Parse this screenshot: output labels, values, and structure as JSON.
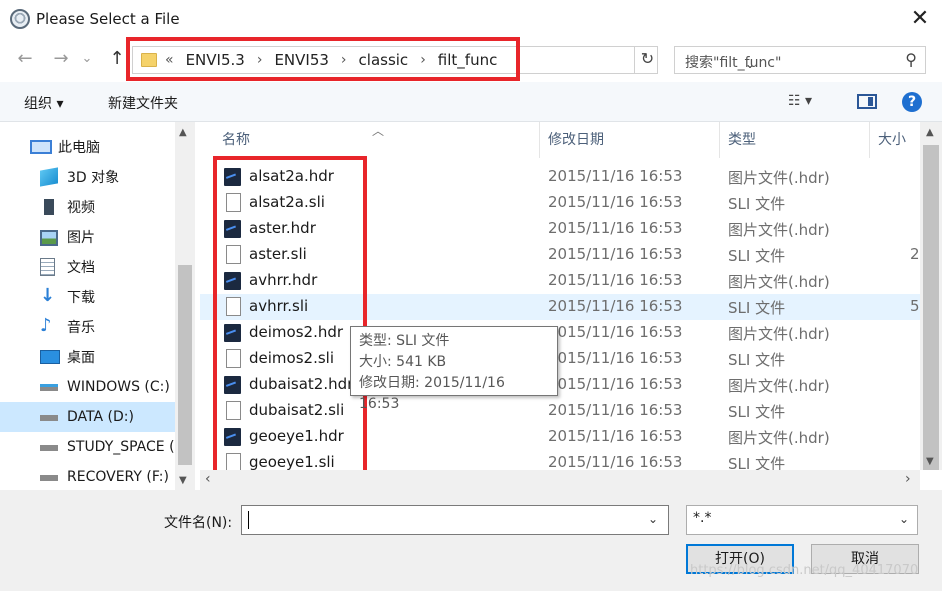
{
  "window": {
    "title": "Please Select a File",
    "close_glyph": "✕"
  },
  "nav": {
    "back_glyph": "←",
    "forward_glyph": "→",
    "dropdown_glyph": "⌄",
    "up_glyph": "↑",
    "crumb_prefix": "«",
    "breadcrumbs": [
      "ENVI5.3",
      "ENVI53",
      "classic",
      "filt_func"
    ],
    "crumb_sep": "›",
    "refresh_glyph": "↻",
    "search_placeholder": "搜索\"filt_func\"",
    "search_glyph": "⚲"
  },
  "toolbar": {
    "organize": "组织 ▾",
    "new_folder": "新建文件夹",
    "view_glyph": "☷ ▾",
    "help_glyph": "?"
  },
  "sidebar": {
    "items": [
      {
        "label": "此电脑",
        "icon": "computer-icon"
      },
      {
        "label": "3D 对象",
        "icon": "3d-objects-icon"
      },
      {
        "label": "视频",
        "icon": "video-icon"
      },
      {
        "label": "图片",
        "icon": "pictures-icon"
      },
      {
        "label": "文档",
        "icon": "documents-icon"
      },
      {
        "label": "下载",
        "icon": "downloads-icon"
      },
      {
        "label": "音乐",
        "icon": "music-icon"
      },
      {
        "label": "桌面",
        "icon": "desktop-icon"
      },
      {
        "label": "WINDOWS (C:)",
        "icon": "drive-icon"
      },
      {
        "label": "DATA (D:)",
        "icon": "drive-icon",
        "selected": true
      },
      {
        "label": "STUDY_SPACE (",
        "icon": "drive-icon"
      },
      {
        "label": "RECOVERY (F:)",
        "icon": "drive-icon"
      }
    ]
  },
  "columns": {
    "name": "名称",
    "modified": "修改日期",
    "type": "类型",
    "size": "大小"
  },
  "files": [
    {
      "name": "alsat2a.hdr",
      "date": "2015/11/16 16:53",
      "type": "图片文件(.hdr)",
      "size": "",
      "kind": "hdr"
    },
    {
      "name": "alsat2a.sli",
      "date": "2015/11/16 16:53",
      "type": "SLI 文件",
      "size": "",
      "kind": "sli"
    },
    {
      "name": "aster.hdr",
      "date": "2015/11/16 16:53",
      "type": "图片文件(.hdr)",
      "size": "",
      "kind": "hdr"
    },
    {
      "name": "aster.sli",
      "date": "2015/11/16 16:53",
      "type": "SLI 文件",
      "size": "2",
      "kind": "sli"
    },
    {
      "name": "avhrr.hdr",
      "date": "2015/11/16 16:53",
      "type": "图片文件(.hdr)",
      "size": "",
      "kind": "hdr"
    },
    {
      "name": "avhrr.sli",
      "date": "2015/11/16 16:53",
      "type": "SLI 文件",
      "size": "5",
      "kind": "sli",
      "hover": true
    },
    {
      "name": "deimos2.hdr",
      "date": "2015/11/16 16:53",
      "type": "图片文件(.hdr)",
      "size": "",
      "kind": "hdr"
    },
    {
      "name": "deimos2.sli",
      "date": "2015/11/16 16:53",
      "type": "SLI 文件",
      "size": "",
      "kind": "sli"
    },
    {
      "name": "dubaisat2.hdr",
      "date": "2015/11/16 16:53",
      "type": "图片文件(.hdr)",
      "size": "",
      "kind": "hdr"
    },
    {
      "name": "dubaisat2.sli",
      "date": "2015/11/16 16:53",
      "type": "SLI 文件",
      "size": "",
      "kind": "sli"
    },
    {
      "name": "geoeye1.hdr",
      "date": "2015/11/16 16:53",
      "type": "图片文件(.hdr)",
      "size": "",
      "kind": "hdr"
    },
    {
      "name": "geoeye1.sli",
      "date": "2015/11/16 16:53",
      "type": "SLI 文件",
      "size": "",
      "kind": "sli"
    }
  ],
  "tooltip": {
    "line1": "类型: SLI 文件",
    "line2": "大小: 541 KB",
    "line3": "修改日期: 2015/11/16 16:53"
  },
  "bottom": {
    "filename_label": "文件名(N):",
    "filename_value": "",
    "filter_value": "*.*",
    "open_label": "打开(O)",
    "cancel_label": "取消",
    "dropdown_glyph": "⌄"
  },
  "watermark": "https://blog.csdn.net/qq_40417070",
  "colors": {
    "highlight_box": "#e8252a",
    "selection": "#cce8ff",
    "hover_row": "#e5f3ff",
    "accent": "#0078d7"
  }
}
